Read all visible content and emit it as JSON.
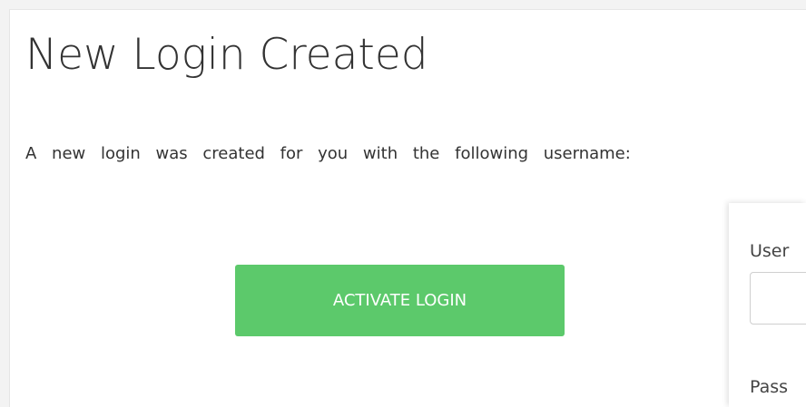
{
  "page": {
    "title": "New Login Created",
    "message": "A new login was created for you with the following username:"
  },
  "actions": {
    "activate_label": "ACTIVATE LOGIN"
  },
  "login_form": {
    "username_label": "User",
    "username_value": "",
    "password_label": "Pass"
  },
  "colors": {
    "accent": "#5cc96b",
    "background": "#f3f3f3",
    "card": "#ffffff",
    "text": "#333333"
  }
}
